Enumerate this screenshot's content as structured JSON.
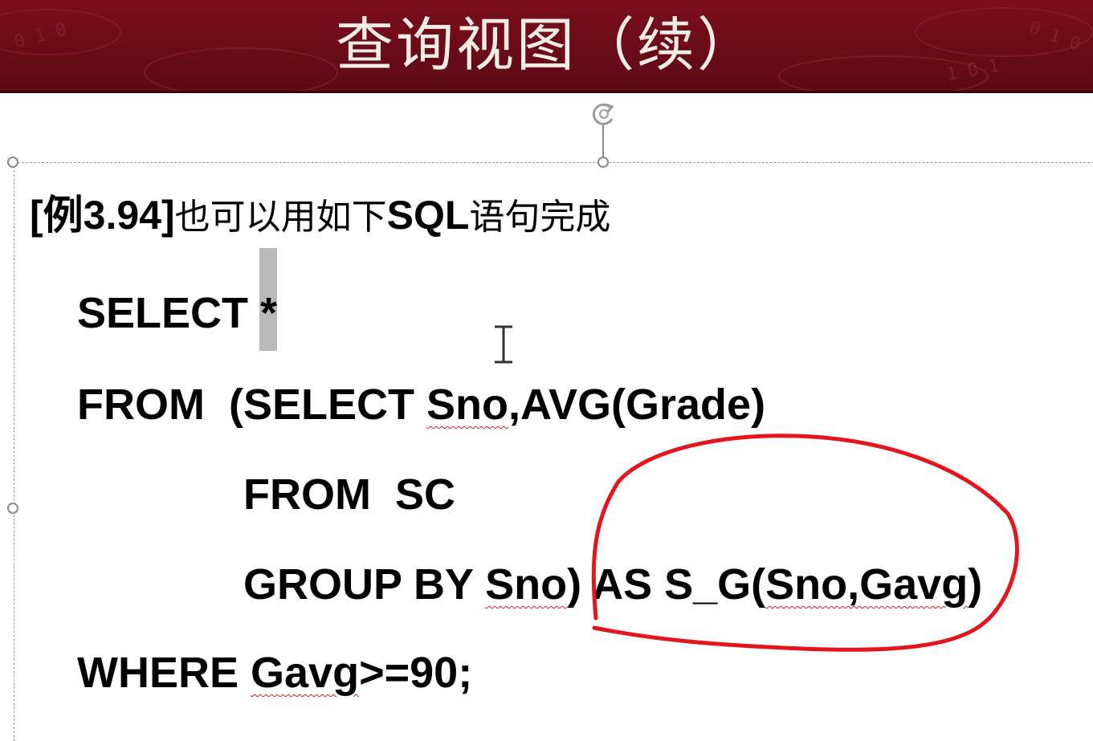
{
  "slide": {
    "title": "查询视图（续）",
    "example_id": "[例3.94]",
    "intro_part1": "也可以用如下",
    "intro_sql": "SQL",
    "intro_part2": "语句完成"
  },
  "code": {
    "select_kw": "SELECT",
    "select_star": "*",
    "from_kw": "FROM",
    "sub_select": "(SELECT",
    "sno_1": "Sno",
    "avg_expr": ",AVG(Grade)",
    "inner_from": "FROM  SC",
    "group_by": "GROUP BY",
    "sno_2": "Sno",
    "paren_close": ")",
    "as_alias": "AS S_G(",
    "sno_gavg": "Sno,Gavg",
    "alias_close": ")",
    "where_kw": "WHERE",
    "gavg": "Gavg",
    "condition": ">=90;"
  },
  "annotation": {
    "ink_color": "#e3161e"
  }
}
